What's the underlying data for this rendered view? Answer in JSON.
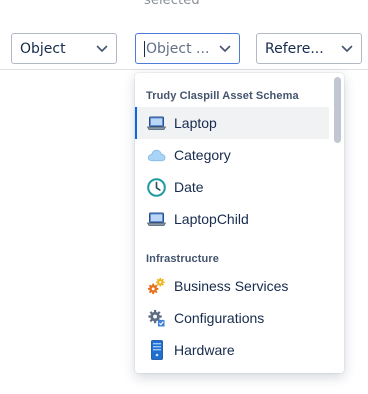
{
  "caption": "selected",
  "filters": {
    "object": {
      "label": "Object"
    },
    "object_type": {
      "placeholder": "Object ..."
    },
    "reference": {
      "label": "Refere..."
    }
  },
  "dropdown": {
    "groups": [
      {
        "heading": "Trudy Claspill Asset Schema",
        "items": [
          {
            "label": "Laptop",
            "icon": "laptop-icon",
            "selected": true
          },
          {
            "label": "Category",
            "icon": "cloud-icon"
          },
          {
            "label": "Date",
            "icon": "clock-icon"
          },
          {
            "label": "LaptopChild",
            "icon": "laptop-icon"
          }
        ]
      },
      {
        "heading": "Infrastructure",
        "items": [
          {
            "label": "Business Services",
            "icon": "gears-icon"
          },
          {
            "label": "Configurations",
            "icon": "config-gear-icon"
          },
          {
            "label": "Hardware",
            "icon": "server-icon"
          }
        ]
      }
    ]
  },
  "colors": {
    "accent": "#0c66e4",
    "focus_border": "#4c7bd9",
    "clock": "#1f9aa3",
    "cloud": "#a9d4f5",
    "server": "#1f6fd1"
  }
}
